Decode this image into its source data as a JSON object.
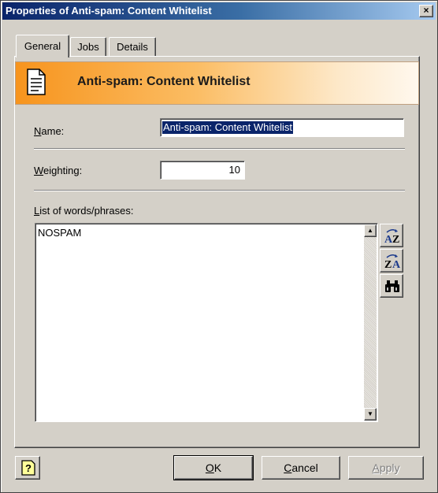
{
  "window": {
    "title": "Properties of Anti-spam: Content Whitelist",
    "close_label": "×"
  },
  "tabs": [
    {
      "label": "General",
      "active": true
    },
    {
      "label": "Jobs",
      "active": false
    },
    {
      "label": "Details",
      "active": false
    }
  ],
  "banner": {
    "title": "Anti-spam: Content Whitelist",
    "icon": "document-icon"
  },
  "form": {
    "name_label_access": "N",
    "name_label_rest": "ame:",
    "name_value": "Anti-spam: Content Whitelist",
    "weighting_label_access": "W",
    "weighting_label_rest": "eighting:",
    "weighting_value": "10",
    "list_label_access": "L",
    "list_label_rest": "ist of words/phrases:",
    "list_items": "NOSPAM"
  },
  "list_tools": [
    {
      "name": "sort-ascending-icon"
    },
    {
      "name": "sort-descending-icon"
    },
    {
      "name": "find-binoculars-icon"
    }
  ],
  "buttons": {
    "ok_access": "O",
    "ok_rest": "K",
    "cancel_access": "C",
    "cancel_rest": "ancel",
    "apply_access": "A",
    "apply_rest": "pply"
  },
  "colors": {
    "title_gradient_start": "#0a246a",
    "banner_accent": "#f7941d",
    "face": "#d4d0c8"
  }
}
